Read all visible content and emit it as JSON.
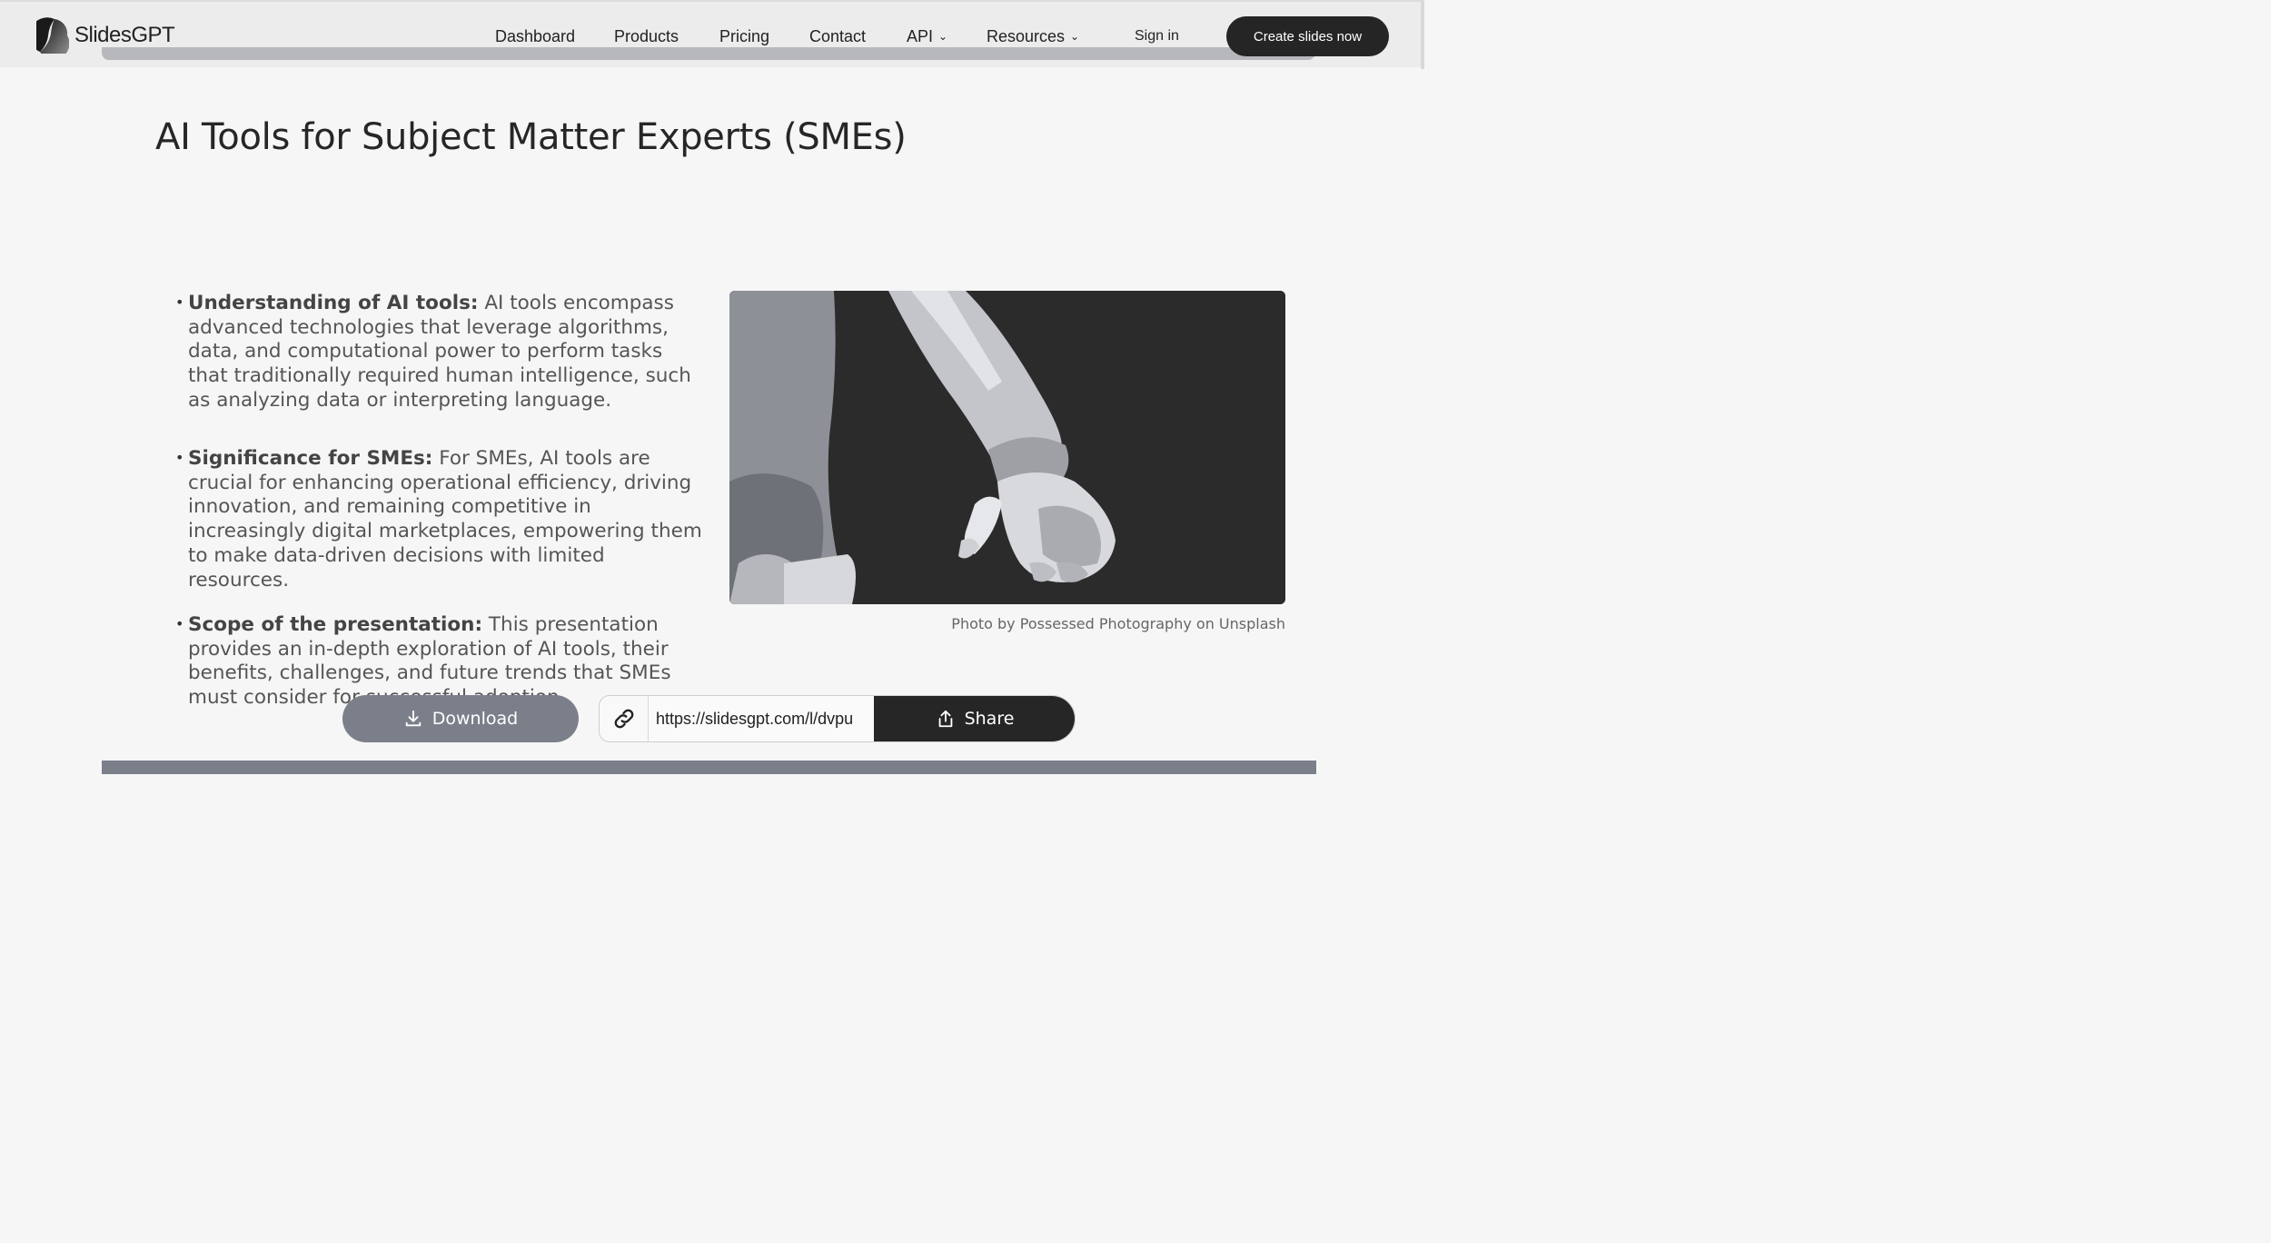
{
  "header": {
    "logo_text": "SlidesGPT",
    "nav": [
      {
        "label": "Dashboard",
        "dropdown": false
      },
      {
        "label": "Products",
        "dropdown": false
      },
      {
        "label": "Pricing",
        "dropdown": false
      },
      {
        "label": "Contact",
        "dropdown": false
      },
      {
        "label": "API",
        "dropdown": true
      },
      {
        "label": "Resources",
        "dropdown": true
      }
    ],
    "signin_label": "Sign in",
    "cta_label": "Create slides now"
  },
  "slide": {
    "title": "AI Tools for Subject Matter Experts (SMEs)",
    "bullets": [
      {
        "heading": "Understanding of AI tools:",
        "text": " AI tools encompass advanced technologies that leverage algorithms, data, and computational power to perform tasks that traditionally required human intelligence, such as analyzing data or interpreting language."
      },
      {
        "heading": "Significance for SMEs:",
        "text": " For SMEs, AI tools are crucial for enhancing operational efficiency, driving innovation, and remaining competitive in increasingly digital marketplaces, empowering them to make data-driven decisions with limited resources."
      },
      {
        "heading": "Scope of the presentation:",
        "text": " This presentation provides an in-depth exploration of AI tools, their benefits, challenges, and future trends that SMEs must consider for successful adoption."
      }
    ],
    "photo_credit": "Photo by Possessed Photography on Unsplash"
  },
  "actions": {
    "download_label": "Download",
    "share_url": "https://slidesgpt.com/l/dvpu",
    "share_label": "Share"
  },
  "colors": {
    "cta_bg": "#252525",
    "download_bg": "#7b7f8a",
    "share_bg": "#262626",
    "page_bg": "#f6f6f6"
  }
}
